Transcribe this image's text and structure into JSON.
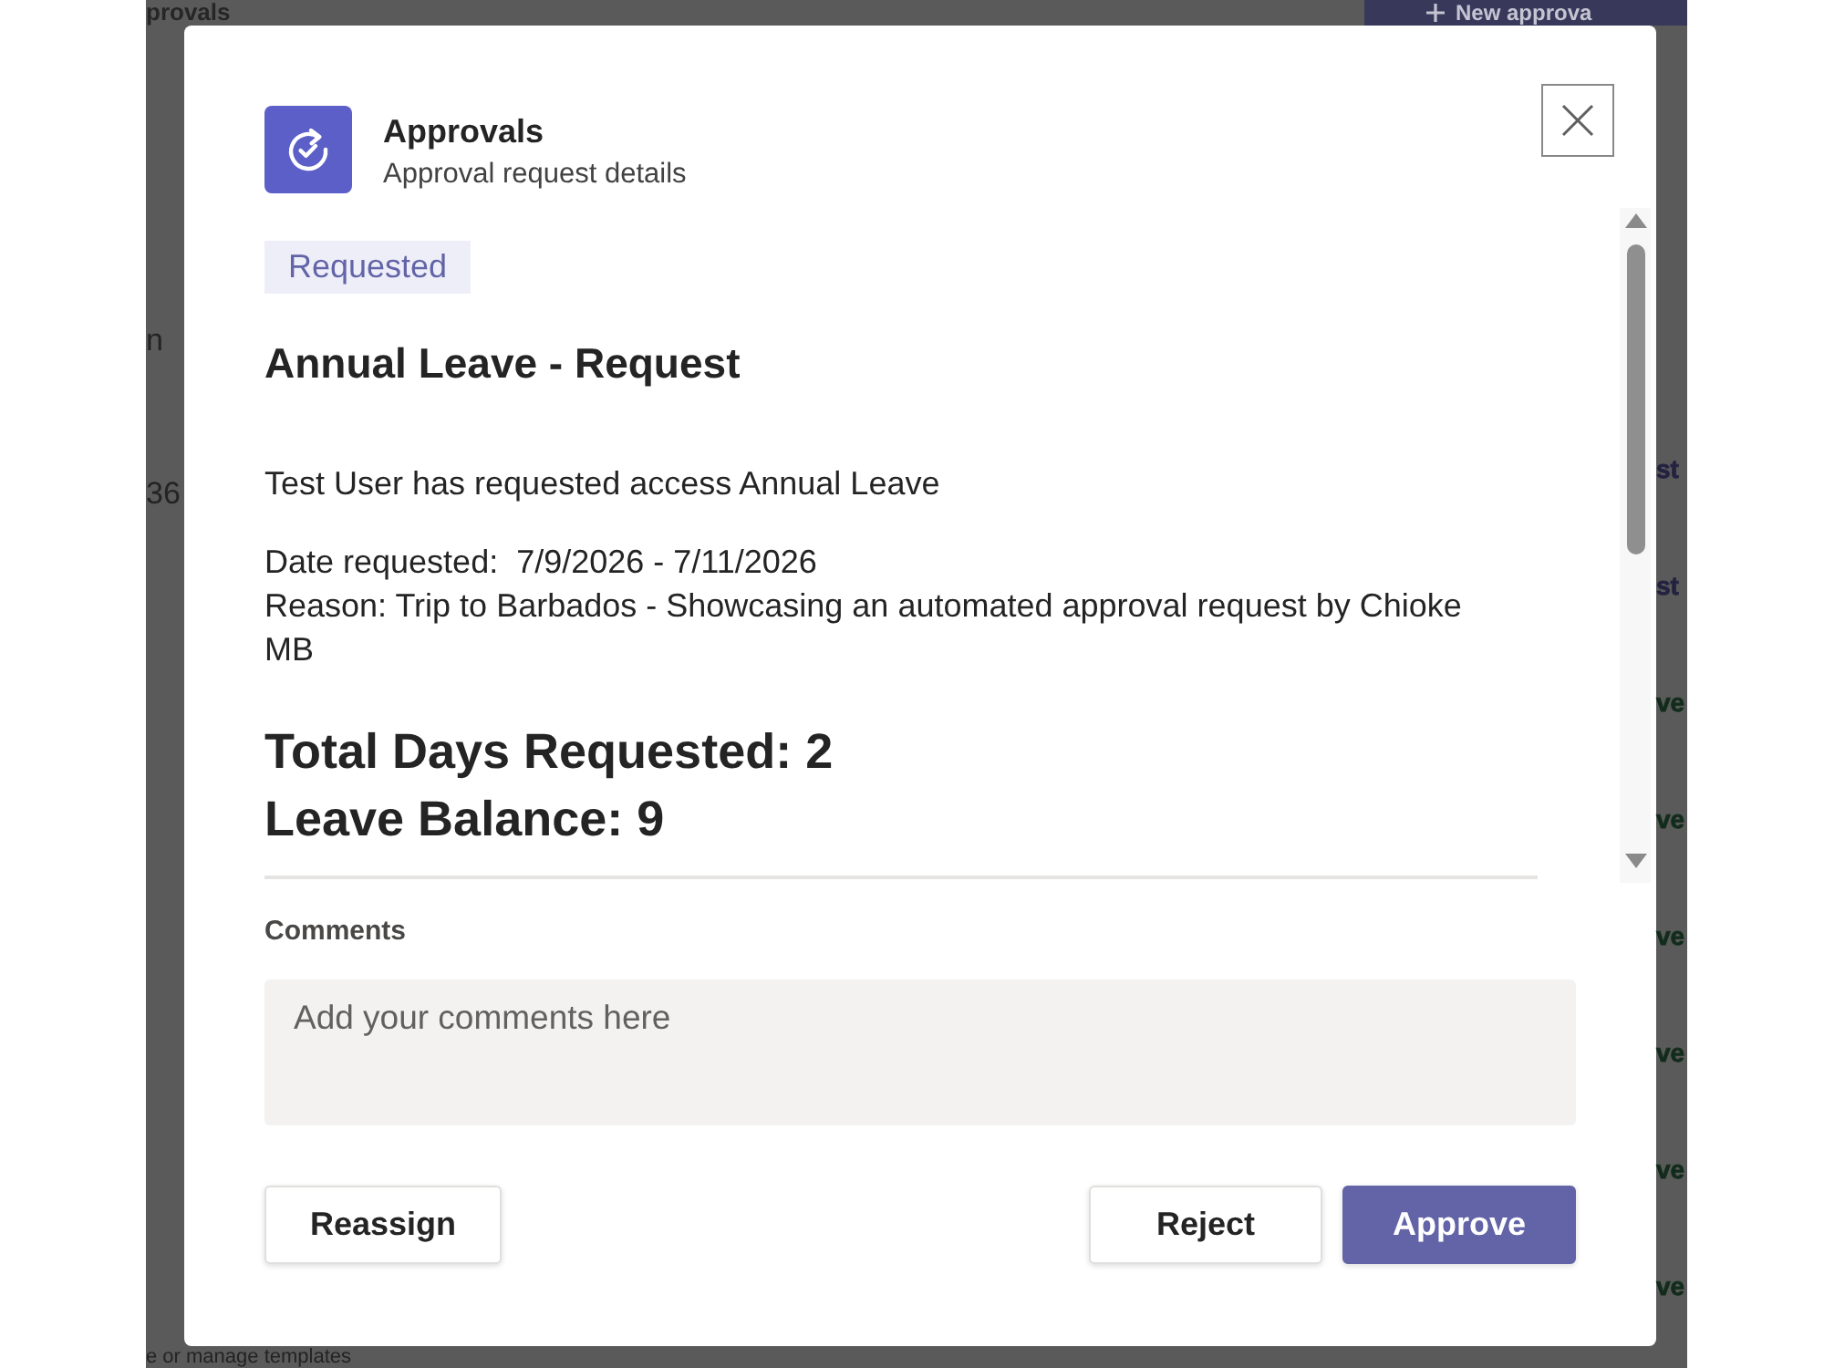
{
  "background": {
    "page_title": "provals",
    "new_button": {
      "label": "New approva"
    },
    "list_fragments": [
      {
        "text": "n"
      },
      {
        "text": "36"
      }
    ],
    "status_fragments": [
      {
        "text": "st",
        "color": "#242240"
      },
      {
        "text": "st",
        "color": "#242240"
      },
      {
        "text": "ve",
        "color": "#122c1b"
      },
      {
        "text": "ve",
        "color": "#122c1b"
      },
      {
        "text": "ve",
        "color": "#122c1b"
      },
      {
        "text": "ve",
        "color": "#122c1b"
      },
      {
        "text": "ve",
        "color": "#122c1b"
      },
      {
        "text": "ve",
        "color": "#122c1b"
      }
    ],
    "templates_link": "e or manage templates"
  },
  "dialog": {
    "app_name": "Approvals",
    "subtitle": "Approval request details",
    "status": {
      "label": "Requested"
    },
    "title": "Annual Leave - Request",
    "summary": "Test User has requested access Annual Leave",
    "details": [
      "Date requested:  7/9/2026 - 7/11/2026",
      "Reason: Trip to Barbados - Showcasing an automated approval request by Chioke MB"
    ],
    "totals": [
      "Total Days Requested: 2",
      "Leave Balance: 9"
    ],
    "comments": {
      "label": "Comments",
      "placeholder": "Add your comments here"
    },
    "footer": {
      "start_buttons": [
        {
          "label": "Reassign",
          "kind": "default"
        }
      ],
      "end_buttons": [
        {
          "label": "Reject",
          "kind": "default"
        },
        {
          "label": "Approve",
          "kind": "primary"
        }
      ]
    }
  }
}
